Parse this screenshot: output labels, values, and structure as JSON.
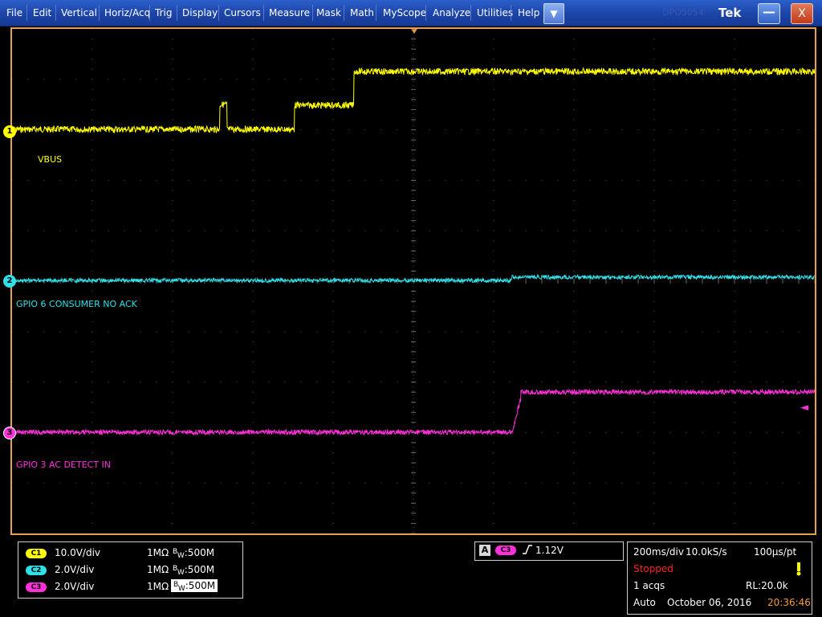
{
  "menu": [
    "File",
    "Edit",
    "Vertical",
    "Horiz/Acq",
    "Trig",
    "Display",
    "Cursors",
    "Measure",
    "Mask",
    "Math",
    "MyScope",
    "Analyze",
    "Utilities",
    "Help"
  ],
  "window": {
    "brand": "Tek",
    "ghost_text": "DPO5054",
    "minimize_icon": "minimize-icon",
    "close_label": "X",
    "dropdown_icon": "chevron-down-icon"
  },
  "colors": {
    "ch1": "#ffff00",
    "ch2": "#2fe0e8",
    "ch3": "#ff2fd9",
    "accent": "#f39c3c"
  },
  "channels": {
    "ch1": {
      "marker": "1",
      "label": "VBUS"
    },
    "ch2": {
      "marker": "2",
      "label": "GPIO 6 CONSUMER NO ACK"
    },
    "ch3": {
      "marker": "3",
      "label": "GPIO 3 AC DETECT IN"
    }
  },
  "vertical": [
    {
      "badge": "C1",
      "scale": "10.0V/div",
      "impedance": "1MΩ",
      "bw_prefix": "B",
      "bw_sub": "W",
      "bw": ":500M"
    },
    {
      "badge": "C2",
      "scale": "2.0V/div",
      "impedance": "1MΩ",
      "bw_prefix": "B",
      "bw_sub": "W",
      "bw": ":500M"
    },
    {
      "badge": "C3",
      "scale": "2.0V/div",
      "impedance": "1MΩ",
      "bw_prefix": "B",
      "bw_sub": "W",
      "bw": ":500M"
    }
  ],
  "trigger": {
    "badge_a": "A",
    "source": "C3",
    "edge_icon": "rising-edge-icon",
    "level": "1.12V"
  },
  "acquisition": {
    "timebase": "200ms/div",
    "sample_rate": "10.0kS/s",
    "resolution": "100µs/pt",
    "state": "Stopped",
    "acqs": "1 acqs",
    "record_length": "RL:20.0k",
    "mode": "Auto",
    "date": "October 06, 2016",
    "time": "20:36:46"
  }
}
